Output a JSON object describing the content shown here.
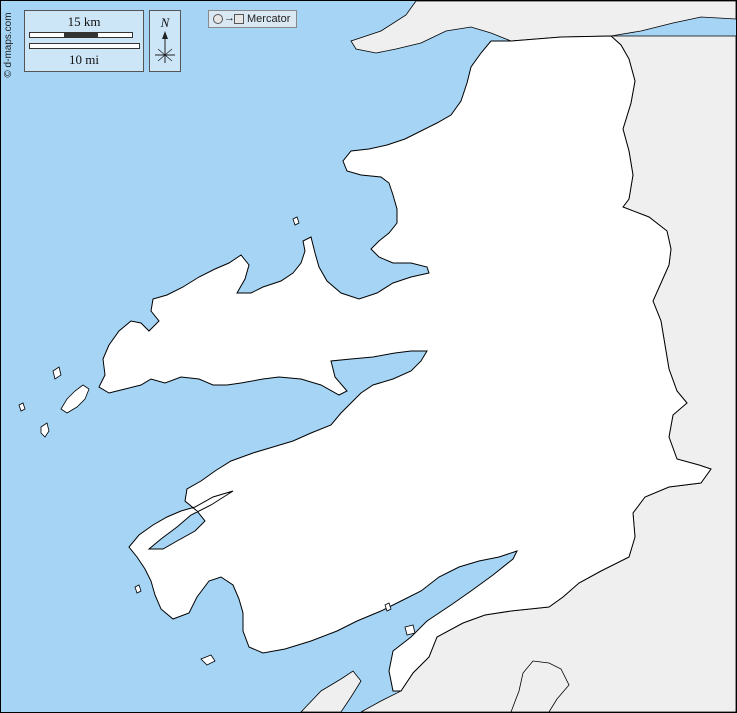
{
  "map": {
    "credit": "© d-maps.com",
    "projection_label": "Mercator",
    "north_label": "N",
    "scale": {
      "km_label": "15 km",
      "mi_label": "10 mi"
    },
    "colors": {
      "sea": "#a5d4f5",
      "target_land": "#ffffff",
      "other_land": "#efefef",
      "border": "#000000"
    }
  }
}
